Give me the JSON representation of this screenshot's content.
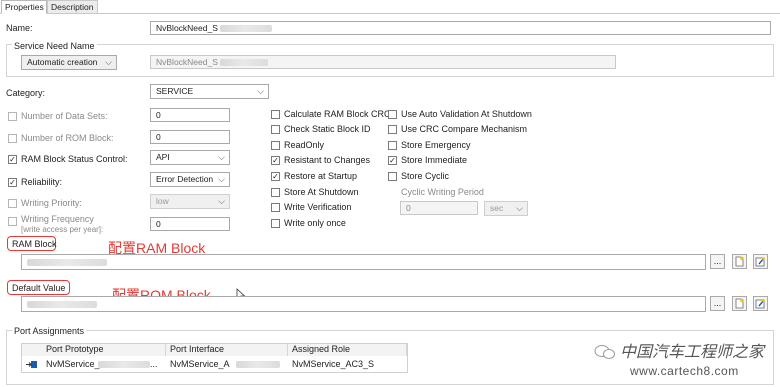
{
  "tabs": {
    "properties": "Properties",
    "description": "Description"
  },
  "name": {
    "label": "Name:",
    "value": "NvBlockNeed_S"
  },
  "service_need_name": {
    "group_label": "Service Need Name",
    "mode": "Automatic creation",
    "value": "NvBlockNeed_S"
  },
  "category": {
    "label": "Category:",
    "value": "SERVICE"
  },
  "left_fields": {
    "data_sets": {
      "label": "Number of Data Sets:",
      "value": "0"
    },
    "rom_block": {
      "label": "Number of ROM Block:",
      "value": "0"
    },
    "ram_status": {
      "label": "RAM Block Status Control:",
      "value": "API"
    },
    "reliability": {
      "label": "Reliability:",
      "value": "Error Detection"
    },
    "writing_priority": {
      "label": "Writing Priority:",
      "value": "low"
    },
    "writing_frequency": {
      "label": "Writing Frequency",
      "sublabel": "[write access per year]:",
      "value": "0"
    }
  },
  "middle_checks": {
    "calc_crc": "Calculate RAM Block CRC",
    "check_static": "Check Static Block ID",
    "readonly": "ReadOnly",
    "resistant": "Resistant to Changes",
    "restore": "Restore at Startup",
    "store_shutdown": "Store At Shutdown",
    "write_verification": "Write Verification",
    "write_once": "Write only once"
  },
  "right_checks": {
    "auto_validation": "Use Auto Validation At Shutdown",
    "crc_compare": "Use CRC Compare Mechanism",
    "store_emergency": "Store Emergency",
    "store_immediate": "Store Immediate",
    "store_cyclic": "Store Cyclic",
    "cyclic_period_label": "Cyclic Writing Period",
    "cyclic_period_value": "0",
    "cyclic_unit": "sec"
  },
  "ram_block": {
    "label": "RAM Block",
    "annotation": "配置RAM Block",
    "browse": "..."
  },
  "default_value": {
    "label": "Default Value",
    "annotation": "配置ROM Block",
    "browse": "..."
  },
  "ports": {
    "group_label": "Port Assignments",
    "columns": [
      "Port Prototype",
      "Port Interface",
      "Assigned Role"
    ],
    "row": [
      "NvMService_",
      "NvMService_A",
      "NvMService_AC3_S"
    ],
    "ellipsis": "..."
  },
  "watermark": {
    "site": "www.cartech8.com"
  },
  "colors": {
    "annotation_red": "#e53935",
    "border": "#a9a9a9"
  },
  "icons": [
    "checkmark-icon",
    "chevron-down-icon",
    "new-file-icon",
    "edit-icon",
    "port-icon",
    "mouse-cursor-icon",
    "wechat-logo-icon"
  ]
}
